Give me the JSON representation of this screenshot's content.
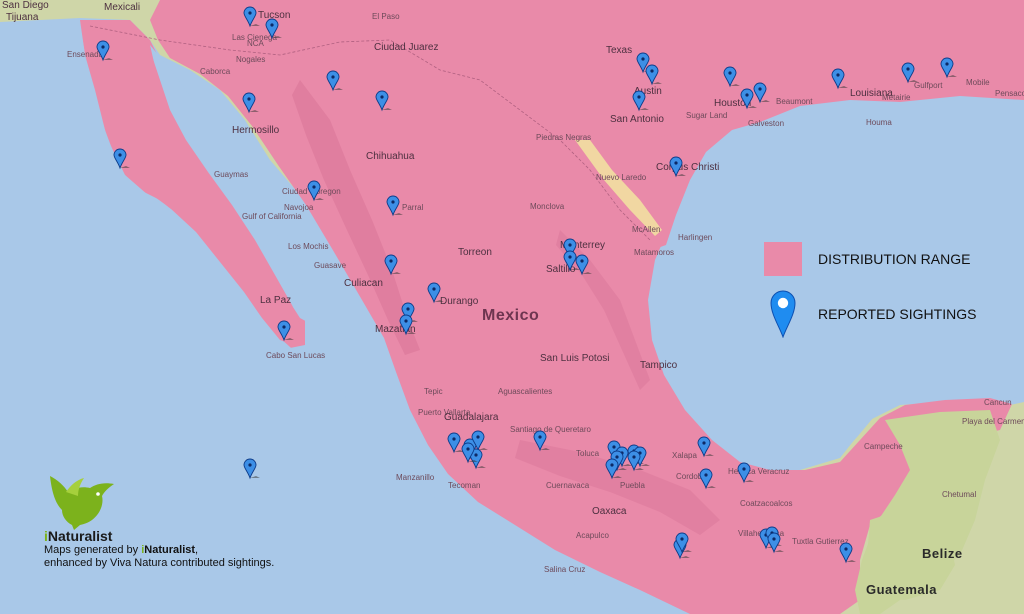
{
  "colors": {
    "water": "#a9c8e8",
    "land": "#cfd6a8",
    "range": "#e98aa9",
    "range_dark": "#d9749a",
    "pin": "#3d8fe6",
    "pin_outline": "#0d3b88"
  },
  "map": {
    "country_label": "Mexico",
    "belize_label": "Belize",
    "guatemala_label": "Guatemala",
    "places": [
      {
        "name": "San Diego",
        "big": true
      },
      {
        "name": "Tijuana",
        "big": true
      },
      {
        "name": "Mexicali",
        "big": true
      },
      {
        "name": "Ensenada",
        "big": false
      },
      {
        "name": "Tucson",
        "big": true
      },
      {
        "name": "Las Cienega",
        "big": false
      },
      {
        "name": "NCA",
        "big": false
      },
      {
        "name": "Nogales",
        "big": false
      },
      {
        "name": "Caborca",
        "big": false
      },
      {
        "name": "Ciudad Juarez",
        "big": true
      },
      {
        "name": "El Paso",
        "big": false
      },
      {
        "name": "Hermosillo",
        "big": true
      },
      {
        "name": "Guaymas",
        "big": false
      },
      {
        "name": "Chihuahua",
        "big": true
      },
      {
        "name": "Ciudad Obregon",
        "big": false
      },
      {
        "name": "Navojoa",
        "big": false
      },
      {
        "name": "Parral",
        "big": false
      },
      {
        "name": "Gulf of California",
        "big": false
      },
      {
        "name": "Los Mochis",
        "big": false
      },
      {
        "name": "Guasave",
        "big": false
      },
      {
        "name": "Culiacan",
        "big": true
      },
      {
        "name": "La Paz",
        "big": true
      },
      {
        "name": "Mazatlan",
        "big": true
      },
      {
        "name": "Cabo San Lucas",
        "big": false
      },
      {
        "name": "Durango",
        "big": true
      },
      {
        "name": "Torreon",
        "big": true
      },
      {
        "name": "Monclova",
        "big": false
      },
      {
        "name": "Piedras Negras",
        "big": false
      },
      {
        "name": "Nuevo Laredo",
        "big": false
      },
      {
        "name": "Monterrey",
        "big": true
      },
      {
        "name": "Saltillo",
        "big": true
      },
      {
        "name": "McAllen",
        "big": false
      },
      {
        "name": "Harlingen",
        "big": false
      },
      {
        "name": "Matamoros",
        "big": false
      },
      {
        "name": "Texas",
        "big": true
      },
      {
        "name": "Austin",
        "big": true
      },
      {
        "name": "San Antonio",
        "big": true
      },
      {
        "name": "Houston",
        "big": true
      },
      {
        "name": "Sugar Land",
        "big": false
      },
      {
        "name": "Galveston",
        "big": false
      },
      {
        "name": "Beaumont",
        "big": false
      },
      {
        "name": "Corpus Christi",
        "big": true
      },
      {
        "name": "Louisiana",
        "big": true
      },
      {
        "name": "Metairie",
        "big": false
      },
      {
        "name": "Houma",
        "big": false
      },
      {
        "name": "Gulfport",
        "big": false
      },
      {
        "name": "Mobile",
        "big": false
      },
      {
        "name": "Pensacola",
        "big": false
      },
      {
        "name": "Tampico",
        "big": true
      },
      {
        "name": "San Luis Potosi",
        "big": true
      },
      {
        "name": "Aguascalientes",
        "big": false
      },
      {
        "name": "Tepic",
        "big": false
      },
      {
        "name": "Puerto Vallarta",
        "big": false
      },
      {
        "name": "Guadalajara",
        "big": true
      },
      {
        "name": "Santiago de Queretaro",
        "big": false
      },
      {
        "name": "Toluca",
        "big": false
      },
      {
        "name": "Cuernavaca",
        "big": false
      },
      {
        "name": "Puebla",
        "big": false
      },
      {
        "name": "Xalapa",
        "big": false
      },
      {
        "name": "Heroica Veracruz",
        "big": false
      },
      {
        "name": "Cordoba",
        "big": false
      },
      {
        "name": "Coatzacoalcos",
        "big": false
      },
      {
        "name": "Manzanillo",
        "big": false
      },
      {
        "name": "Tecoman",
        "big": false
      },
      {
        "name": "Acapulco",
        "big": false
      },
      {
        "name": "Oaxaca",
        "big": true
      },
      {
        "name": "Salina Cruz",
        "big": false
      },
      {
        "name": "Tuxtla Gutierrez",
        "big": false
      },
      {
        "name": "Campeche",
        "big": false
      },
      {
        "name": "Chetumal",
        "big": false
      },
      {
        "name": "Cancun",
        "big": false
      },
      {
        "name": "Playa del Carmen",
        "big": false
      },
      {
        "name": "Villahermosa",
        "big": false
      }
    ],
    "pin_count": 62
  },
  "legend": {
    "range_label": "DISTRIBUTION RANGE",
    "sightings_label": "REPORTED SIGHTINGS"
  },
  "credit": {
    "logo_i": "i",
    "logo_rest": "Naturalist",
    "line1_prefix": "Maps generated by ",
    "line1_brand_i": "i",
    "line1_brand_rest": "Naturalist",
    "line1_suffix": ",",
    "line2": "enhanced by Viva Natura contributed sightings."
  }
}
